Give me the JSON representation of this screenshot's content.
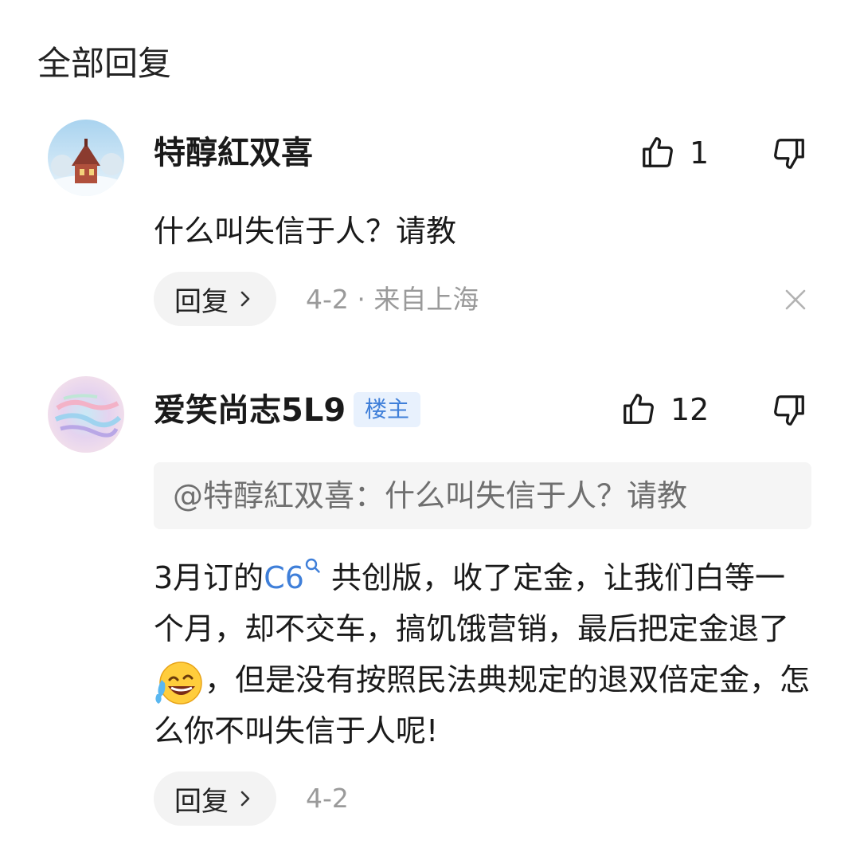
{
  "section_title": "全部回复",
  "comments": [
    {
      "username": "特醇紅双喜",
      "likes": "1",
      "text": "什么叫失信于人？请教",
      "reply_label": "回复",
      "meta": "4-2 · 来自上海"
    },
    {
      "username": "爱笑尚志5L9",
      "badge": "楼主",
      "likes": "12",
      "quote": "@特醇紅双喜：什么叫失信于人？请教",
      "body_part1": "3月订的",
      "link_text": "C6",
      "body_part2": " 共创版，收了定金，让我们白等一个月，却不交车，搞饥饿营销，最后把定金退了",
      "body_part3": "，但是没有按照民法典规定的退双倍定金，怎么你不叫失信于人呢!",
      "reply_label": "回复",
      "meta": "4-2"
    }
  ],
  "icons": {
    "like": "thumbs-up-icon",
    "dislike": "thumbs-down-icon",
    "close": "close-icon",
    "search": "search-icon",
    "chevron": "chevron-right-icon",
    "emoji": "laughing-crying-emoji"
  },
  "colors": {
    "badge_text": "#3f7fd9",
    "badge_bg": "#e8f1fd",
    "link": "#3f7fd9",
    "meta": "#9a9a9a"
  }
}
